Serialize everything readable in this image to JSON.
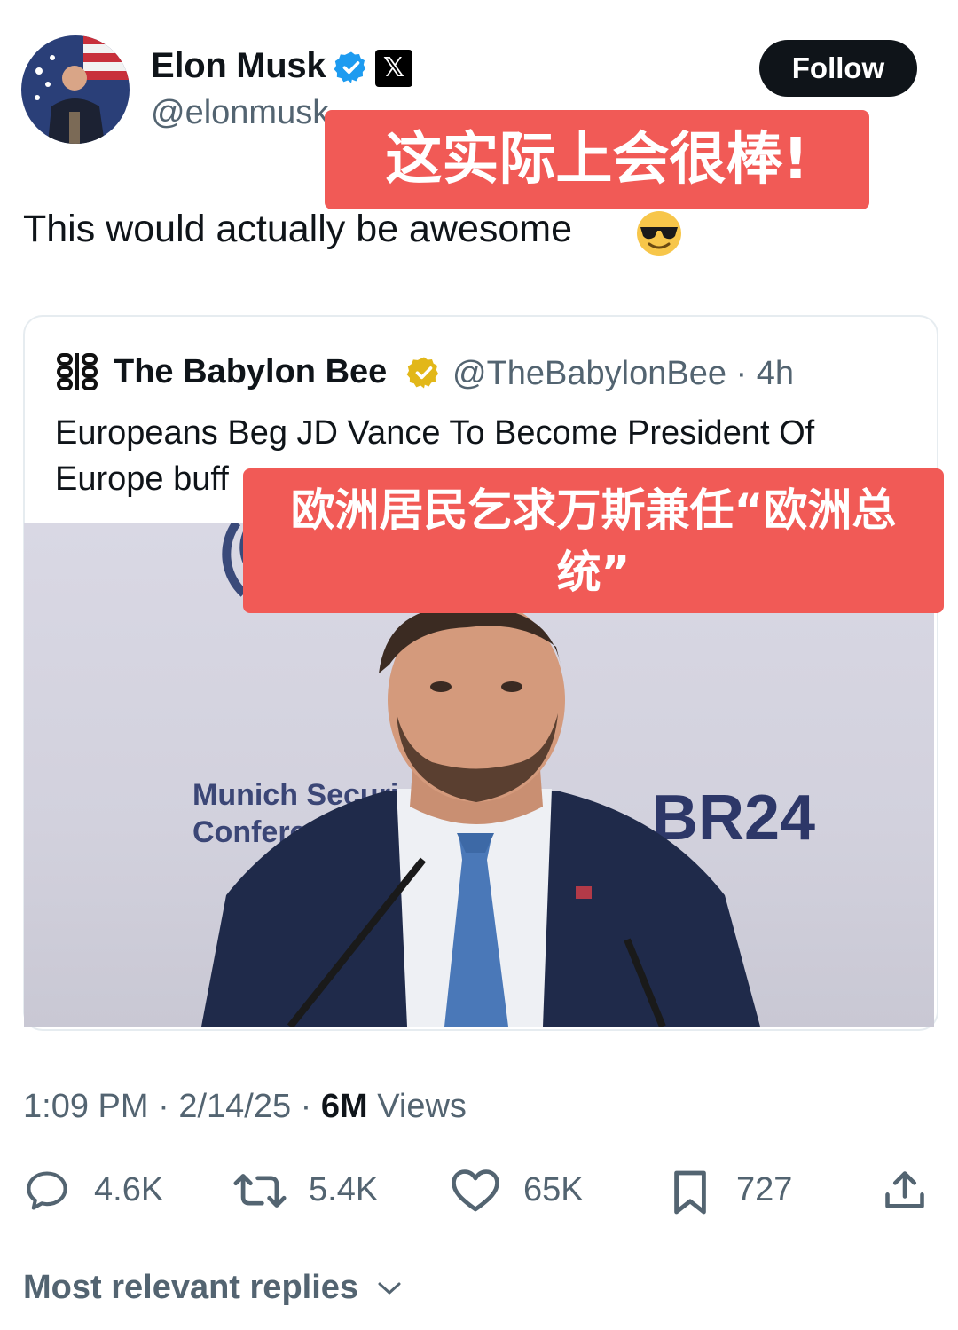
{
  "author": {
    "name": "Elon Musk",
    "handle": "@elonmusk",
    "follow_label": "Follow",
    "avatar_icon": "avatar-photo"
  },
  "tweet": {
    "text": "This would actually be awesome",
    "emoji": "😎"
  },
  "overlay_captions": {
    "caption_top": "这实际上会很棒!",
    "caption_middle_line1": "欧洲居民乞求万斯兼任“欧洲总",
    "caption_middle_line2": "统”"
  },
  "quoted": {
    "name": "The Babylon Bee",
    "handle": "@TheBabylonBee",
    "age": "4h",
    "text_line1": "Europeans Beg JD Vance To Become President Of",
    "text_line2": "Europe buff",
    "photo_text_1": "Munich Securi",
    "photo_text_2": "Conferenc",
    "photo_logo": "BR24"
  },
  "meta": {
    "time": "1:09 PM",
    "date": "2/14/25",
    "views_count": "6M",
    "views_label": "Views"
  },
  "actions": {
    "replies": "4.6K",
    "reposts": "5.4K",
    "likes": "65K",
    "bookmarks": "727"
  },
  "replies_sort_label": "Most relevant replies",
  "colors": {
    "caption_bg": "#f15a56",
    "verified_blue": "#1d9bf0",
    "verified_gold": "#e2b719",
    "text_secondary": "#536471"
  }
}
